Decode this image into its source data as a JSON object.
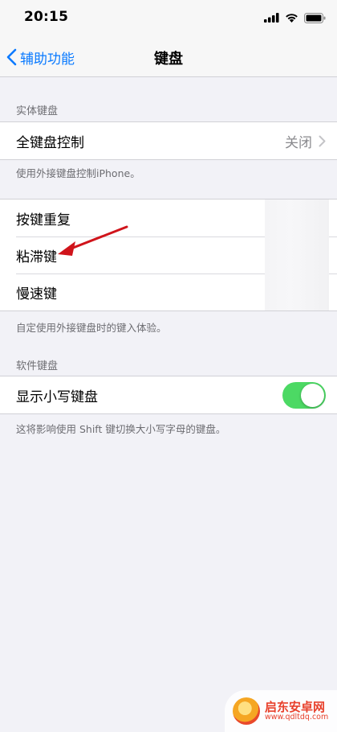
{
  "status_bar": {
    "time": "20:15"
  },
  "nav": {
    "back_label": "辅助功能",
    "title": "键盘"
  },
  "section_physical": {
    "header": "实体键盘",
    "rows": [
      {
        "label": "全键盘控制",
        "value": "关闭"
      }
    ],
    "footer": "使用外接键盘控制iPhone。"
  },
  "section_keys": {
    "rows": [
      {
        "label": "按键重复"
      },
      {
        "label": "粘滞键"
      },
      {
        "label": "慢速键"
      }
    ],
    "footer": "自定使用外接键盘时的键入体验。"
  },
  "section_software": {
    "header": "软件键盘",
    "rows": [
      {
        "label": "显示小写键盘",
        "toggle_on": true
      }
    ],
    "footer": "这将影响使用 Shift 键切换大小写字母的键盘。"
  },
  "watermark": {
    "title": "启东安卓网",
    "url": "www.qdltdq.com"
  },
  "colors": {
    "accent": "#0a7aff",
    "toggle_on": "#4cd964",
    "arrow": "#d0141b"
  },
  "icons": [
    "signal-icon",
    "wifi-icon",
    "battery-icon",
    "chevron-left-icon",
    "chevron-right-icon",
    "annotation-arrow"
  ]
}
